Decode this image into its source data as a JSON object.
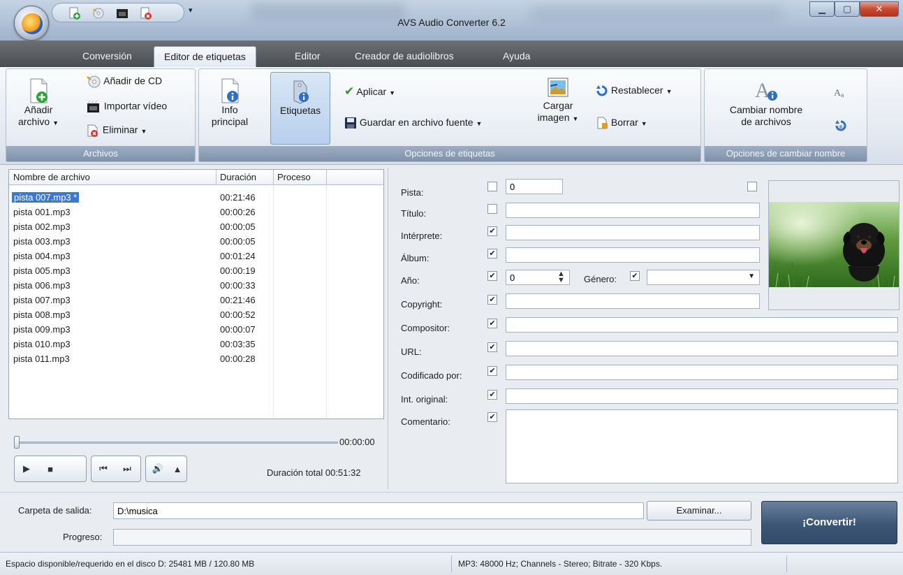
{
  "window": {
    "title": "AVS Audio Converter 6.2"
  },
  "menu": {
    "tabs": [
      "Conversión",
      "Editor de etiquetas",
      "Editor",
      "Creador de audiolibros",
      "Ayuda"
    ],
    "active": "Editor de etiquetas"
  },
  "ribbon": {
    "archivos": {
      "label": "Archivos",
      "add_file_line1": "Añadir",
      "add_file_line2": "archivo",
      "add_cd": "Añadir de CD",
      "import_video": "Importar vídeo",
      "remove": "Eliminar"
    },
    "tags": {
      "label": "Opciones de etiquetas",
      "info_line1": "Info",
      "info_line2": "principal",
      "tags_btn": "Etiquetas",
      "apply": "Aplicar",
      "save_source": "Guardar en archivo fuente",
      "load_image_line1": "Cargar",
      "load_image_line2": "imagen",
      "reset": "Restablecer",
      "delete": "Borrar"
    },
    "rename": {
      "label": "Opciones de cambiar nombre",
      "rename_line1": "Cambiar nombre",
      "rename_line2": "de archivos"
    }
  },
  "filelist": {
    "headers": {
      "name": "Nombre de archivo",
      "duration": "Duración",
      "process": "Proceso"
    },
    "rows": [
      {
        "name": "pista 007.mp3 *",
        "duration": "00:21:46"
      },
      {
        "name": "pista 001.mp3",
        "duration": "00:00:26"
      },
      {
        "name": "pista 002.mp3",
        "duration": "00:00:05"
      },
      {
        "name": "pista 003.mp3",
        "duration": "00:00:05"
      },
      {
        "name": "pista 004.mp3",
        "duration": "00:01:24"
      },
      {
        "name": "pista 005.mp3",
        "duration": "00:00:19"
      },
      {
        "name": "pista 006.mp3",
        "duration": "00:00:33"
      },
      {
        "name": "pista 007.mp3",
        "duration": "00:21:46"
      },
      {
        "name": "pista 008.mp3",
        "duration": "00:00:52"
      },
      {
        "name": "pista 009.mp3",
        "duration": "00:00:07"
      },
      {
        "name": "pista 010.mp3",
        "duration": "00:03:35"
      },
      {
        "name": "pista 011.mp3",
        "duration": "00:00:28"
      }
    ]
  },
  "player": {
    "current_time": "00:00:00",
    "total_label": "Duración total",
    "total_time": "00:51:32"
  },
  "tags": {
    "pista_label": "Pista:",
    "pista_value": "0",
    "titulo_label": "Título:",
    "interprete_label": "Intérprete:",
    "album_label": "Álbum:",
    "anio_label": "Año:",
    "anio_value": "0",
    "genero_label": "Género:",
    "copyright_label": "Copyright:",
    "compositor_label": "Compositor:",
    "url_label": "URL:",
    "codificado_label": "Codificado por:",
    "int_original_label": "Int. original:",
    "comentario_label": "Comentario:",
    "check_mark": "✔"
  },
  "output": {
    "folder_label": "Carpeta de salida:",
    "folder_value": "D:\\musica",
    "browse": "Examinar...",
    "progress_label": "Progreso:",
    "convert": "¡Convertir!"
  },
  "status": {
    "disk": "Espacio disponible/requerido en el disco D: 25481 MB / 120.80 MB",
    "format": "MP3: 48000  Hz; Channels - Stereo; Bitrate - 320 Kbps."
  }
}
